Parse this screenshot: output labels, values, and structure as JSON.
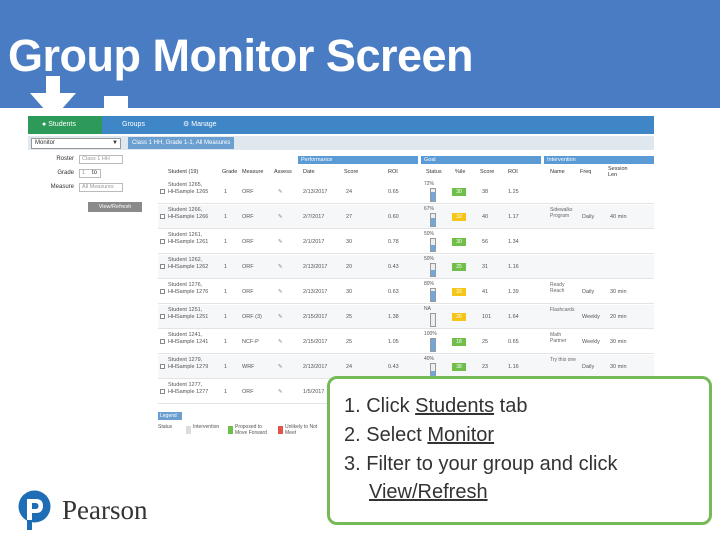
{
  "slide": {
    "title": "Group Monitor Screen",
    "brand": "Pearson"
  },
  "app": {
    "tabs": {
      "students": "Students",
      "groups": "Groups",
      "manage": "Manage"
    },
    "monitor_select": "Monitor",
    "sub_info": "Class 1 HH, Grade 1-1, All Measures",
    "filters": {
      "roster_label": "Roster",
      "roster_value": "Class 1 HH",
      "grade_label": "Grade",
      "grade_value": "1",
      "grade_suffix": "to",
      "measure_label": "Measure",
      "measure_value": "All Measures",
      "view_refresh": "View/Refresh"
    },
    "header_groups": {
      "performance": "Performance",
      "goal": "Goal",
      "intervention": "Intervention"
    },
    "columns": [
      "Student (19)",
      "Grade",
      "Measure",
      "Assess",
      "Date",
      "Score",
      "ROI",
      "Status",
      "%ile",
      "Score",
      "ROI",
      "Name",
      "Freq",
      "Session Len"
    ],
    "rows": [
      {
        "student": "Student 1265, HHSample 1265",
        "grade": "1",
        "measure": "ORF",
        "date": "2/13/2017",
        "score": "24",
        "roi": "0.65",
        "status": "72%",
        "pct": 72,
        "pill": "30",
        "pill_color": "#6fbf4a",
        "gscore": "38",
        "groi": "1.25",
        "int_name": "",
        "freq": "",
        "len": ""
      },
      {
        "student": "Student 1266, HHSample 1266",
        "grade": "1",
        "measure": "ORF",
        "date": "2/7/2017",
        "score": "27",
        "roi": "0.60",
        "status": "67%",
        "pct": 67,
        "pill": "32",
        "pill_color": "#f5c518",
        "gscore": "40",
        "groi": "1.17",
        "int_name": "Sidewalks Program",
        "freq": "Daily",
        "len": "40 min"
      },
      {
        "student": "Student 1261, HHSample 1261",
        "grade": "1",
        "measure": "ORF",
        "date": "2/1/2017",
        "score": "30",
        "roi": "0.78",
        "status": "50%",
        "pct": 50,
        "pill": "30",
        "pill_color": "#6fbf4a",
        "gscore": "56",
        "groi": "1.34",
        "int_name": "",
        "freq": "",
        "len": ""
      },
      {
        "student": "Student 1262, HHSample 1262",
        "grade": "1",
        "measure": "ORF",
        "date": "2/13/2017",
        "score": "20",
        "roi": "0.43",
        "status": "50%",
        "pct": 50,
        "pill": "25",
        "pill_color": "#6fbf4a",
        "gscore": "31",
        "groi": "1.16",
        "int_name": "",
        "freq": "",
        "len": ""
      },
      {
        "student": "Student 1276, HHSample 1276",
        "grade": "1",
        "measure": "ORF",
        "date": "2/13/2017",
        "score": "30",
        "roi": "0.63",
        "status": "80%",
        "pct": 80,
        "pill": "33",
        "pill_color": "#f5c518",
        "gscore": "41",
        "groi": "1.39",
        "int_name": "Ready Reach",
        "freq": "Daily",
        "len": "30 min"
      },
      {
        "student": "Student 1251, HHSample 1251",
        "grade": "1",
        "measure": "ORF (3)",
        "date": "2/15/2017",
        "score": "25",
        "roi": "1.38",
        "status": "NA",
        "pct": 0,
        "pill": "26",
        "pill_color": "#f5c518",
        "gscore": "101",
        "groi": "1.64",
        "int_name": "Flashcards",
        "freq": "Weekly",
        "len": "20 min"
      },
      {
        "student": "Student 1241, HHSample 1241",
        "grade": "1",
        "measure": "NCF-P",
        "date": "2/15/2017",
        "score": "25",
        "roi": "1.05",
        "status": "100%",
        "pct": 100,
        "pill": "18",
        "pill_color": "#6fbf4a",
        "gscore": "25",
        "groi": "0.65",
        "int_name": "Math Partner",
        "freq": "Weekly",
        "len": "30 min"
      },
      {
        "student": "Student 1279, HHSample 1279",
        "grade": "1",
        "measure": "WRF",
        "date": "2/13/2017",
        "score": "24",
        "roi": "0.43",
        "status": "40%",
        "pct": 40,
        "pill": "38",
        "pill_color": "#6fbf4a",
        "gscore": "23",
        "groi": "1.16",
        "int_name": "Try this one",
        "freq": "Daily",
        "len": "30 min"
      },
      {
        "student": "Student 1277, HHSample 1277",
        "grade": "1",
        "measure": "ORF",
        "date": "1/5/2017",
        "score": "",
        "roi": "",
        "status": "",
        "pct": 0,
        "pill": "",
        "pill_color": "#ffffff",
        "gscore": "",
        "groi": "",
        "int_name": "",
        "freq": "",
        "len": ""
      }
    ],
    "legend": {
      "title": "Legend",
      "status_label": "Status",
      "items": [
        "Intervention",
        "Proposed to Move Forward",
        "Unlikely to Not Meet"
      ]
    }
  },
  "instructions": {
    "line1_prefix": "1. Click ",
    "line1_link": "Students",
    "line1_suffix": " tab",
    "line2_prefix": "2. Select ",
    "line2_link": "Monitor",
    "line3": "3. Filter to your group and click",
    "line4_link": "View/Refresh"
  },
  "colors": {
    "band": "#4a7cc4",
    "students_tab": "#2e9a5a",
    "callout_border": "#76b957",
    "pearson_blue": "#1f6db5"
  }
}
